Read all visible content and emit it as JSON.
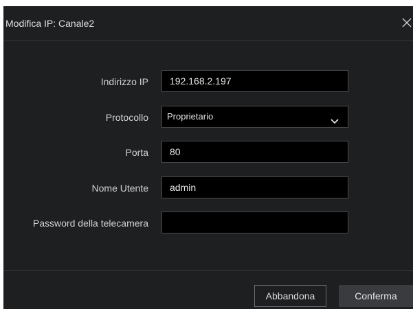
{
  "dialog": {
    "title": "Modifica IP: Canale2",
    "close_icon": "close-icon"
  },
  "form": {
    "ip": {
      "label": "Indirizzo IP",
      "value": "192.168.2.197"
    },
    "protocol": {
      "label": "Protocollo",
      "value": "Proprietario",
      "icon": "chevron-down-icon"
    },
    "port": {
      "label": "Porta",
      "value": "80"
    },
    "username": {
      "label": "Nome Utente",
      "value": "admin"
    },
    "password": {
      "label": "Password della telecamera",
      "value": ""
    }
  },
  "footer": {
    "cancel_label": "Abbandona",
    "confirm_label": "Conferma"
  },
  "colors": {
    "dialog_bg": "#1e1f21",
    "field_bg": "#000000",
    "confirm_bg": "#3a3b3e"
  }
}
